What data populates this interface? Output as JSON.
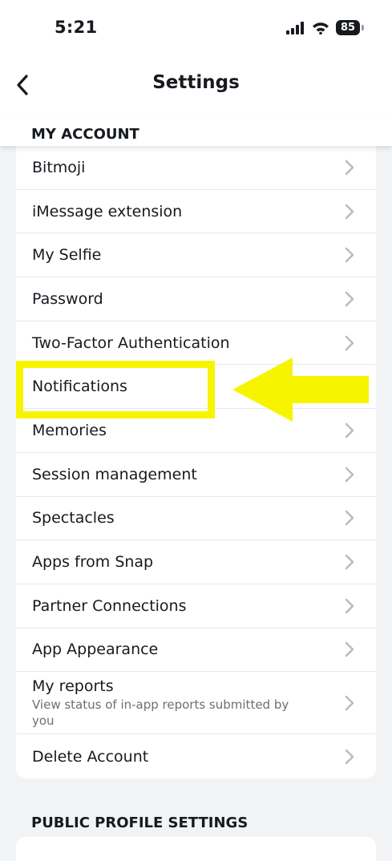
{
  "status_bar": {
    "time": "5:21",
    "battery": "85"
  },
  "header": {
    "title": "Settings"
  },
  "sections": {
    "my_account": "MY ACCOUNT",
    "public_profile": "PUBLIC PROFILE SETTINGS"
  },
  "items": [
    {
      "label": "Bitmoji"
    },
    {
      "label": "iMessage extension"
    },
    {
      "label": "My Selfie"
    },
    {
      "label": "Password"
    },
    {
      "label": "Two-Factor Authentication"
    },
    {
      "label": "Notifications"
    },
    {
      "label": "Memories"
    },
    {
      "label": "Session management"
    },
    {
      "label": "Spectacles"
    },
    {
      "label": "Apps from Snap"
    },
    {
      "label": "Partner Connections"
    },
    {
      "label": "App Appearance"
    },
    {
      "label": "My reports",
      "subtitle": "View status of in-app reports submitted by you"
    },
    {
      "label": "Delete Account"
    }
  ],
  "colors": {
    "highlight": "#f7f400",
    "chevron": "#b9bcc1"
  }
}
